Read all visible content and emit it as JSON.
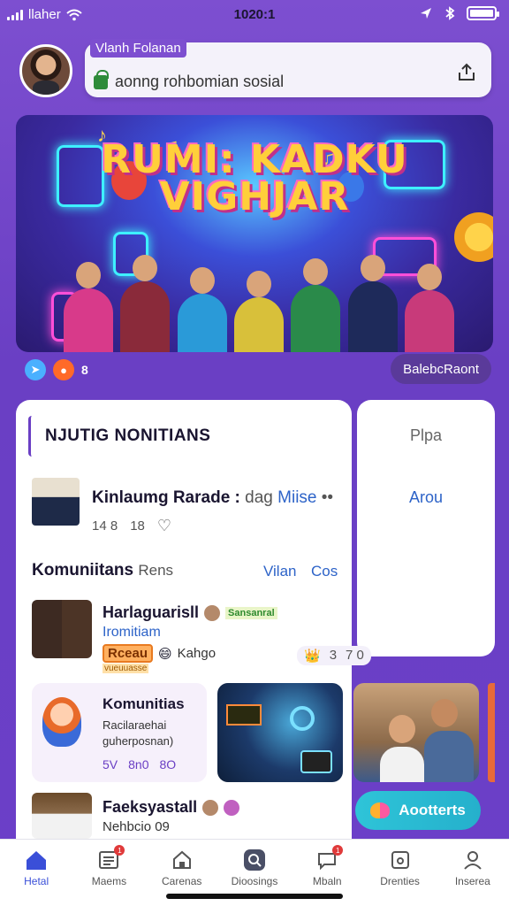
{
  "status_bar": {
    "carrier": "llaher",
    "time": "1020:1",
    "battery_level": 1.0
  },
  "header": {
    "title": "Vlanh Folanan",
    "subtitle": "aonng rohbomian sosial"
  },
  "banner": {
    "title_line1": "RUMI: KADKU",
    "title_line2": "VIGHJAR",
    "indicator_label": "8",
    "button_label": "BalebcRaont"
  },
  "panel": {
    "tab_title": "NJUTIG NONITIANS",
    "side_top": "Plpa",
    "side_link": "Arou"
  },
  "row1": {
    "title": "Kinlaumg Rarade :",
    "extra": "dag",
    "link": "Miise",
    "more": "••",
    "meta_a": "14 8",
    "meta_b": "18"
  },
  "section": {
    "heading": "Komuniitans",
    "heading_sub": "Rens",
    "link1": "Vilan",
    "link2": "Cos"
  },
  "row2": {
    "title": "Harlaguarisll",
    "tag": "Sansanral",
    "subtitle": "Iromitiam",
    "badge": "Rceau",
    "label": "Kahgo",
    "tiny": "vueuuasse",
    "stat_a": "3",
    "stat_b": "7 0"
  },
  "cards": {
    "komunitas": {
      "title": "Komunitias",
      "line1": "Racilaraehai",
      "line2": "guherposnan)",
      "stat_a": "5V",
      "stat_b": "8n0",
      "stat_c": "8O"
    }
  },
  "row3": {
    "title": "Faeksyastall",
    "subtitle": "Nehbcio 09"
  },
  "cta": {
    "label": "Aootterts"
  },
  "tabbar": {
    "items": [
      {
        "label": "Hetal",
        "icon": "home-icon",
        "active": true
      },
      {
        "label": "Maems",
        "icon": "list-icon",
        "badge": "1"
      },
      {
        "label": "Carenas",
        "icon": "house-icon"
      },
      {
        "label": "Dioosings",
        "icon": "search-icon"
      },
      {
        "label": "Mbaln",
        "icon": "chat-icon",
        "badge": "1"
      },
      {
        "label": "Drenties",
        "icon": "box-icon"
      },
      {
        "label": "Inserea",
        "icon": "person-icon"
      }
    ]
  },
  "colors": {
    "background": "#6a3fc4",
    "accent_blue": "#2d63c8",
    "cta": "#2ec4d8",
    "badge_red": "#e03a3a"
  }
}
